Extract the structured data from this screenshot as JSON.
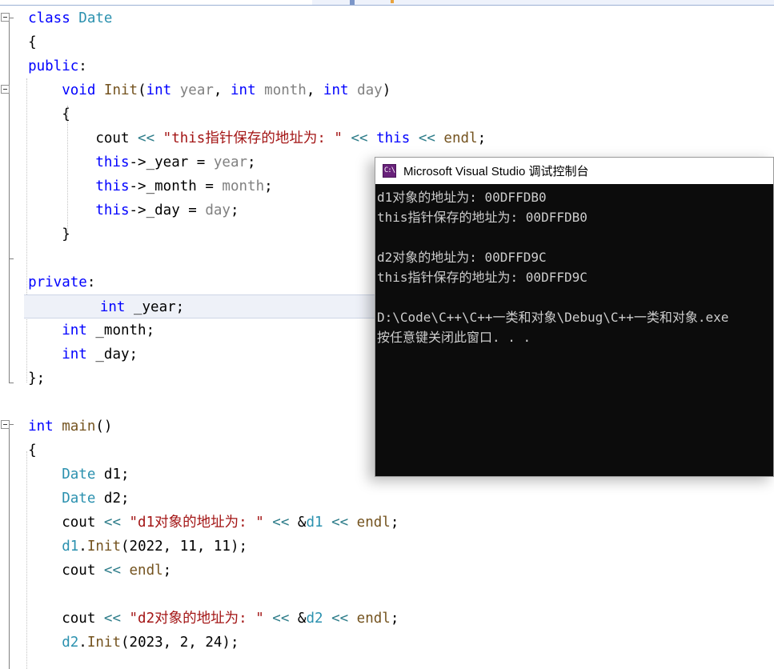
{
  "editor": {
    "language": "cpp",
    "code_lines": [
      {
        "indent": 0,
        "fold": true,
        "tokens": [
          {
            "t": "class ",
            "c": "kw"
          },
          {
            "t": "Date",
            "c": "type"
          }
        ]
      },
      {
        "indent": 0,
        "tokens": [
          {
            "t": "{",
            "c": "pl"
          }
        ]
      },
      {
        "indent": 0,
        "tokens": [
          {
            "t": "public",
            "c": "kw"
          },
          {
            "t": ":",
            "c": "pl"
          }
        ]
      },
      {
        "indent": 1,
        "fold": true,
        "tokens": [
          {
            "t": "void ",
            "c": "kw"
          },
          {
            "t": "Init",
            "c": "fn"
          },
          {
            "t": "(",
            "c": "pl"
          },
          {
            "t": "int ",
            "c": "kw"
          },
          {
            "t": "year",
            "c": "var"
          },
          {
            "t": ", ",
            "c": "pl"
          },
          {
            "t": "int ",
            "c": "kw"
          },
          {
            "t": "month",
            "c": "var"
          },
          {
            "t": ", ",
            "c": "pl"
          },
          {
            "t": "int ",
            "c": "kw"
          },
          {
            "t": "day",
            "c": "var"
          },
          {
            "t": ")",
            "c": "pl"
          }
        ]
      },
      {
        "indent": 1,
        "tokens": [
          {
            "t": "{",
            "c": "pl"
          }
        ]
      },
      {
        "indent": 2,
        "tokens": [
          {
            "t": "cout ",
            "c": "pl"
          },
          {
            "t": "<< ",
            "c": "op"
          },
          {
            "t": "\"this指针保存的地址为: \"",
            "c": "str"
          },
          {
            "t": " ",
            "c": "pl"
          },
          {
            "t": "<< ",
            "c": "op"
          },
          {
            "t": "this",
            "c": "kw"
          },
          {
            "t": " ",
            "c": "pl"
          },
          {
            "t": "<< ",
            "c": "op"
          },
          {
            "t": "endl",
            "c": "fn"
          },
          {
            "t": ";",
            "c": "pl"
          }
        ]
      },
      {
        "indent": 2,
        "tokens": [
          {
            "t": "this",
            "c": "kw"
          },
          {
            "t": "->_year = ",
            "c": "pl"
          },
          {
            "t": "year",
            "c": "var"
          },
          {
            "t": ";",
            "c": "pl"
          }
        ]
      },
      {
        "indent": 2,
        "tokens": [
          {
            "t": "this",
            "c": "kw"
          },
          {
            "t": "->_month = ",
            "c": "pl"
          },
          {
            "t": "month",
            "c": "var"
          },
          {
            "t": ";",
            "c": "pl"
          }
        ]
      },
      {
        "indent": 2,
        "tokens": [
          {
            "t": "this",
            "c": "kw"
          },
          {
            "t": "->_day = ",
            "c": "pl"
          },
          {
            "t": "day",
            "c": "var"
          },
          {
            "t": ";",
            "c": "pl"
          }
        ]
      },
      {
        "indent": 1,
        "tokens": [
          {
            "t": "}",
            "c": "pl"
          }
        ]
      },
      {
        "indent": 0,
        "tokens": []
      },
      {
        "indent": 0,
        "tokens": [
          {
            "t": "private",
            "c": "kw"
          },
          {
            "t": ":",
            "c": "pl"
          }
        ]
      },
      {
        "indent": 1,
        "highlight": true,
        "tokens": [
          {
            "t": "int ",
            "c": "kw"
          },
          {
            "t": "_year;",
            "c": "pl"
          }
        ]
      },
      {
        "indent": 1,
        "tokens": [
          {
            "t": "int ",
            "c": "kw"
          },
          {
            "t": "_month;",
            "c": "pl"
          }
        ]
      },
      {
        "indent": 1,
        "tokens": [
          {
            "t": "int ",
            "c": "kw"
          },
          {
            "t": "_day;",
            "c": "pl"
          }
        ]
      },
      {
        "indent": 0,
        "tokens": [
          {
            "t": "};",
            "c": "pl"
          }
        ]
      },
      {
        "indent": 0,
        "tokens": []
      },
      {
        "indent": 0,
        "fold": true,
        "tokens": [
          {
            "t": "int ",
            "c": "kw"
          },
          {
            "t": "main",
            "c": "fn"
          },
          {
            "t": "()",
            "c": "pl"
          }
        ]
      },
      {
        "indent": 0,
        "tokens": [
          {
            "t": "{",
            "c": "pl"
          }
        ]
      },
      {
        "indent": 1,
        "tokens": [
          {
            "t": "Date ",
            "c": "type"
          },
          {
            "t": "d1;",
            "c": "pl"
          }
        ]
      },
      {
        "indent": 1,
        "tokens": [
          {
            "t": "Date ",
            "c": "type"
          },
          {
            "t": "d2;",
            "c": "pl"
          }
        ]
      },
      {
        "indent": 1,
        "tokens": [
          {
            "t": "cout ",
            "c": "pl"
          },
          {
            "t": "<< ",
            "c": "op"
          },
          {
            "t": "\"d1对象的地址为: \"",
            "c": "str"
          },
          {
            "t": " ",
            "c": "pl"
          },
          {
            "t": "<< ",
            "c": "op"
          },
          {
            "t": "&",
            "c": "pl"
          },
          {
            "t": "d1",
            "c": "obj"
          },
          {
            "t": " ",
            "c": "pl"
          },
          {
            "t": "<< ",
            "c": "op"
          },
          {
            "t": "endl",
            "c": "fn"
          },
          {
            "t": ";",
            "c": "pl"
          }
        ]
      },
      {
        "indent": 1,
        "tokens": [
          {
            "t": "d1",
            "c": "obj"
          },
          {
            "t": ".",
            "c": "pl"
          },
          {
            "t": "Init",
            "c": "fn"
          },
          {
            "t": "(2022, 11, 11);",
            "c": "pl"
          }
        ]
      },
      {
        "indent": 1,
        "tokens": [
          {
            "t": "cout ",
            "c": "pl"
          },
          {
            "t": "<< ",
            "c": "op"
          },
          {
            "t": "endl",
            "c": "fn"
          },
          {
            "t": ";",
            "c": "pl"
          }
        ]
      },
      {
        "indent": 1,
        "tokens": []
      },
      {
        "indent": 1,
        "tokens": [
          {
            "t": "cout ",
            "c": "pl"
          },
          {
            "t": "<< ",
            "c": "op"
          },
          {
            "t": "\"d2对象的地址为: \"",
            "c": "str"
          },
          {
            "t": " ",
            "c": "pl"
          },
          {
            "t": "<< ",
            "c": "op"
          },
          {
            "t": "&",
            "c": "pl"
          },
          {
            "t": "d2",
            "c": "obj"
          },
          {
            "t": " ",
            "c": "pl"
          },
          {
            "t": "<< ",
            "c": "op"
          },
          {
            "t": "endl",
            "c": "fn"
          },
          {
            "t": ";",
            "c": "pl"
          }
        ]
      },
      {
        "indent": 1,
        "tokens": [
          {
            "t": "d2",
            "c": "obj"
          },
          {
            "t": ".",
            "c": "pl"
          },
          {
            "t": "Init",
            "c": "fn"
          },
          {
            "t": "(2023, 2, 24);",
            "c": "pl"
          }
        ]
      }
    ]
  },
  "console": {
    "title": "Microsoft Visual Studio 调试控制台",
    "icon": "console-window-icon",
    "icon_label": "C:\\",
    "background_color": "#0c0c0c",
    "text_color": "#cccccc",
    "lines": [
      "d1对象的地址为: 00DFFDB0",
      "this指针保存的地址为: 00DFFDB0",
      "",
      "d2对象的地址为: 00DFFD9C",
      "this指针保存的地址为: 00DFFD9C",
      "",
      "D:\\Code\\C++\\C++一类和对象\\Debug\\C++一类和对象.exe",
      "按任意键关闭此窗口. . ."
    ]
  },
  "colors": {
    "keyword": "#0000ff",
    "type_name": "#2b91af",
    "function_name": "#74531f",
    "parameter": "#808080",
    "string": "#a31515",
    "operator": "#2e7d8a",
    "current_line_highlight": "#eef1f8",
    "toolbar_strip": "#eef2fb"
  }
}
